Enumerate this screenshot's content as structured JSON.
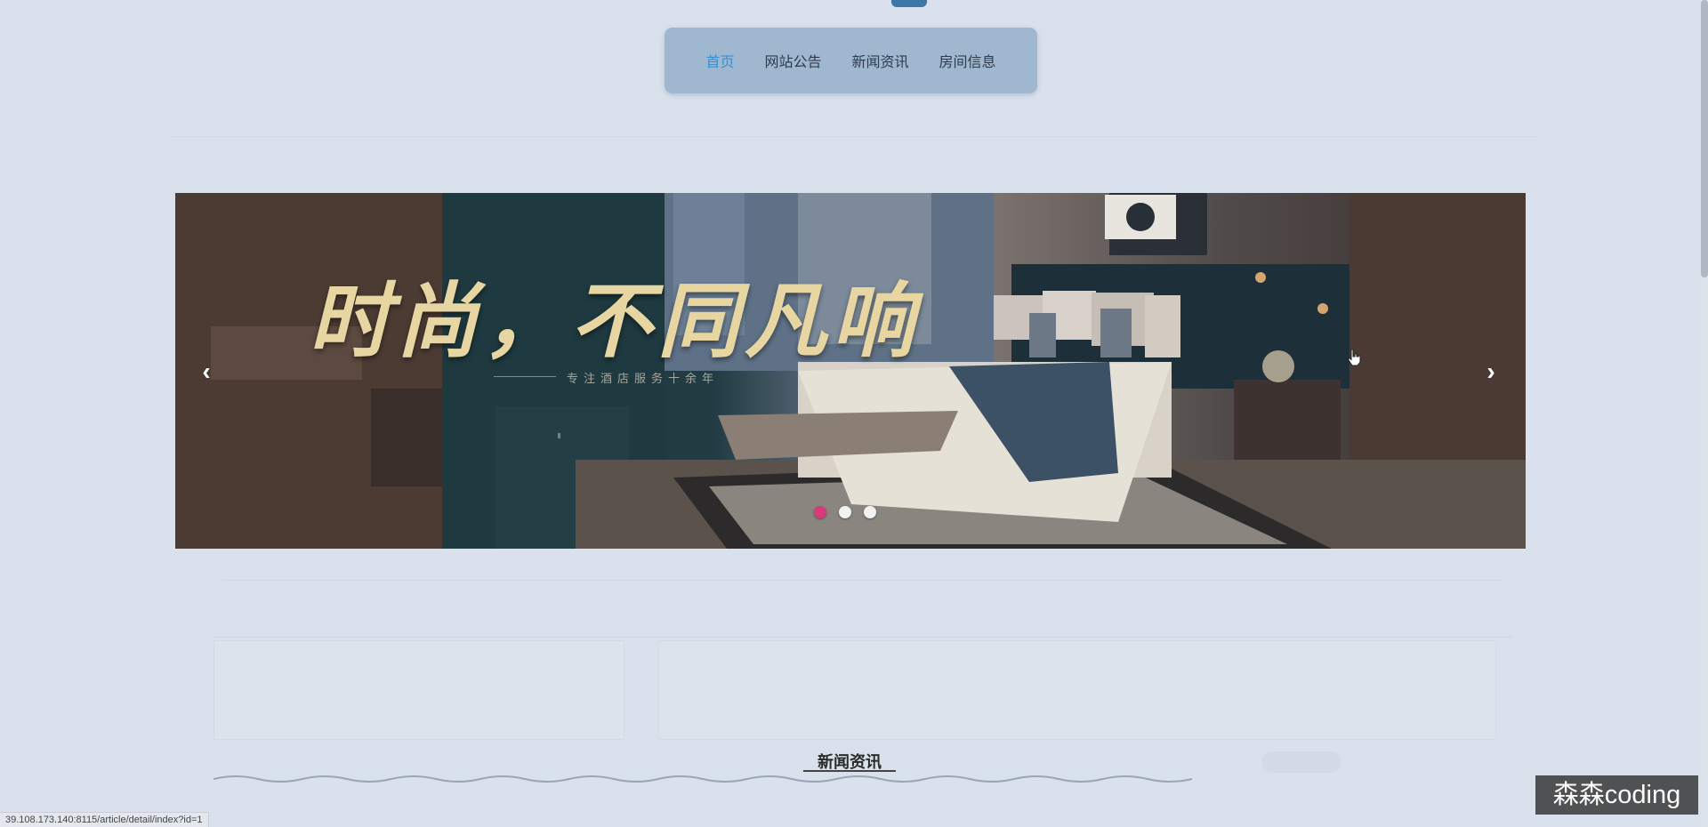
{
  "nav": {
    "items": [
      {
        "label": "首页",
        "active": true
      },
      {
        "label": "网站公告",
        "active": false
      },
      {
        "label": "新闻资讯",
        "active": false
      },
      {
        "label": "房间信息",
        "active": false
      }
    ]
  },
  "banner": {
    "title": "时尚，不同凡响",
    "subtitle": "专注酒店服务十余年",
    "prev_icon": "chevron-left-icon",
    "next_icon": "chevron-right-icon",
    "slides_count": 3,
    "active_slide": 1
  },
  "section": {
    "title": "新闻资讯"
  },
  "status_bar": {
    "url": "39.108.173.140:8115/article/detail/index?id=1"
  },
  "watermark": {
    "text": "森森coding"
  },
  "colors": {
    "background": "#d9e1ec",
    "nav_bg": "#9fb8cf",
    "nav_active": "#3a8ed0",
    "dot_active": "#d83c78"
  }
}
